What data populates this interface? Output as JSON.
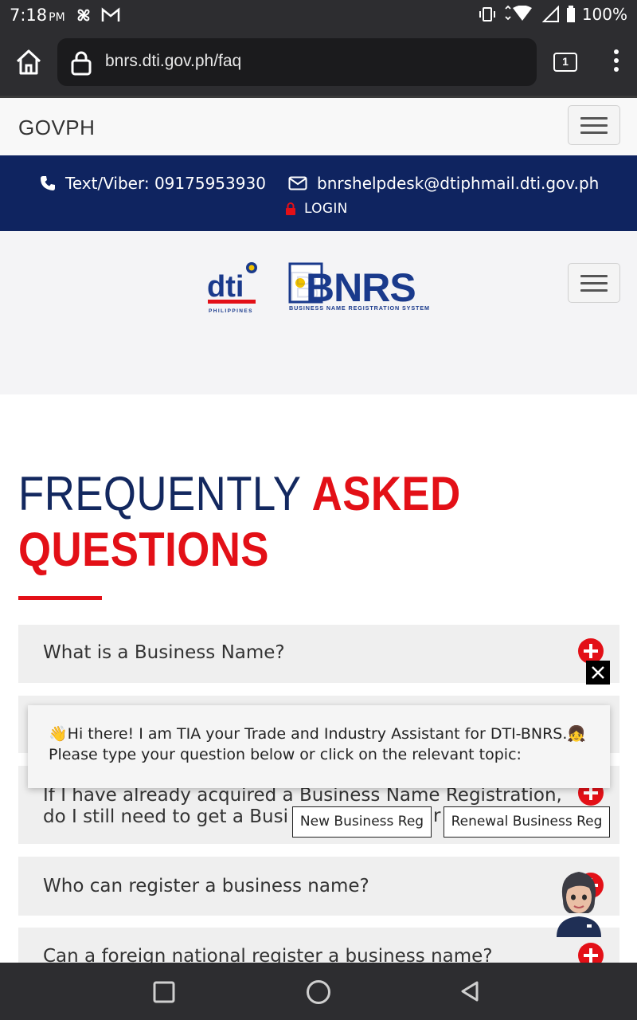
{
  "status_bar": {
    "time": "7:18",
    "ampm": "PM",
    "battery": "100%"
  },
  "browser": {
    "url": "bnrs.dti.gov.ph/faq",
    "tab_count": "1"
  },
  "govph_bar": {
    "brand": "GOVPH"
  },
  "contact": {
    "phone": "Text/Viber: 09175953930",
    "email": "bnrshelpdesk@dtiphmail.dti.gov.ph",
    "login": "LOGIN"
  },
  "logos": {
    "dti": "dti",
    "dti_sub": "PHILIPPINES",
    "bnrs": "BNRS",
    "bnrs_sub": "BUSINESS NAME REGISTRATION SYSTEM"
  },
  "faq": {
    "heading_part1": "FREQUENTLY",
    "heading_part2": "ASKED",
    "heading_part3": "QUESTIONS",
    "items": [
      {
        "question": "What is a Business Name?"
      },
      {
        "question_line1": "If I have already acquired a Business Name Registration,",
        "question_line2": "do I still need to get a Busi",
        "question_tail": "r"
      },
      {
        "question": "Who can register a business name?"
      },
      {
        "question": "Can a foreign national register a business name?"
      }
    ]
  },
  "chat": {
    "greeting_line1": "Hi there! I am TIA your Trade and Industry Assistant for DTI-BNRS.",
    "greeting_line2": "Please type your question below or click on the relevant topic:",
    "wave_emoji": "👋",
    "girl_emoji": "👧",
    "options": [
      "New Business Reg",
      "Renewal Business Reg"
    ]
  },
  "colors": {
    "navy": "#0f2460",
    "red": "#e31017",
    "chrome": "#2d2d30"
  }
}
